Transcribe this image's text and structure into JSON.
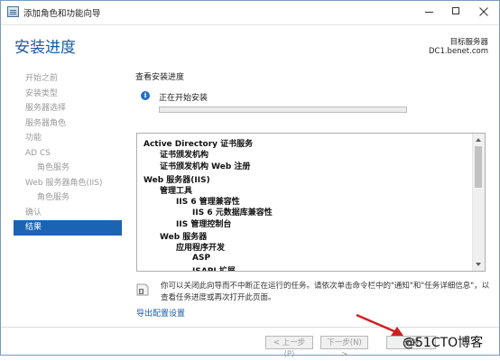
{
  "window": {
    "title": "添加角色和功能向导"
  },
  "header": {
    "page_title": "安装进度",
    "target_label": "目标服务器",
    "target_server": "DC1.benet.com"
  },
  "nav": {
    "items": [
      {
        "label": "开始之前",
        "level": 0,
        "active": false
      },
      {
        "label": "安装类型",
        "level": 0,
        "active": false
      },
      {
        "label": "服务器选择",
        "level": 0,
        "active": false
      },
      {
        "label": "服务器角色",
        "level": 0,
        "active": false
      },
      {
        "label": "功能",
        "level": 0,
        "active": false
      },
      {
        "label": "AD CS",
        "level": 0,
        "active": false
      },
      {
        "label": "角色服务",
        "level": 1,
        "active": false
      },
      {
        "label": "Web 服务器角色(IIS)",
        "level": 0,
        "active": false
      },
      {
        "label": "角色服务",
        "level": 1,
        "active": false
      },
      {
        "label": "确认",
        "level": 0,
        "active": false
      },
      {
        "label": "结果",
        "level": 0,
        "active": true
      }
    ]
  },
  "main": {
    "section_label": "查看安装进度",
    "status_text": "正在开始安装",
    "progress_fraction": 0.0,
    "results": [
      {
        "text": "Active Directory 证书服务",
        "indent": 0
      },
      {
        "text": "证书颁发机构",
        "indent": 1
      },
      {
        "text": "证书颁发机构 Web 注册",
        "indent": 1
      },
      {
        "text": "Web 服务器(IIS)",
        "indent": 0
      },
      {
        "text": "管理工具",
        "indent": 1
      },
      {
        "text": "IIS 6 管理兼容性",
        "indent": 2
      },
      {
        "text": "IIS 6 元数据库兼容性",
        "indent": 3
      },
      {
        "text": "IIS 管理控制台",
        "indent": 2
      },
      {
        "text": "Web 服务器",
        "indent": 1
      },
      {
        "text": "应用程序开发",
        "indent": 2
      },
      {
        "text": "ASP",
        "indent": 3
      },
      {
        "text": "ISAPI 扩展",
        "indent": 3
      }
    ],
    "note_lines": [
      "你可以关闭此向导而不中断正在运行的任务。请依次单击命令栏中的\"通知\"和\"任务详细信息\"，以",
      "查看任务进度或再次打开此页面。"
    ],
    "export_link": "导出配置设置"
  },
  "footer": {
    "prev_label": "< 上一步(P)",
    "next_label": "下一步(N) >",
    "install_label": "安装"
  },
  "overlay": {
    "watermark": "@51CTO博客"
  },
  "colors": {
    "accent": "#1b64b4",
    "title_blue": "#1b5aa0",
    "progress_green": "#06b025",
    "arrow_red": "#d11f1f"
  },
  "icons": {
    "app": "wizard-icon",
    "info": "info-icon",
    "note": "note-icon",
    "minimize": "minimize-icon",
    "maximize": "maximize-icon",
    "close": "close-icon"
  }
}
